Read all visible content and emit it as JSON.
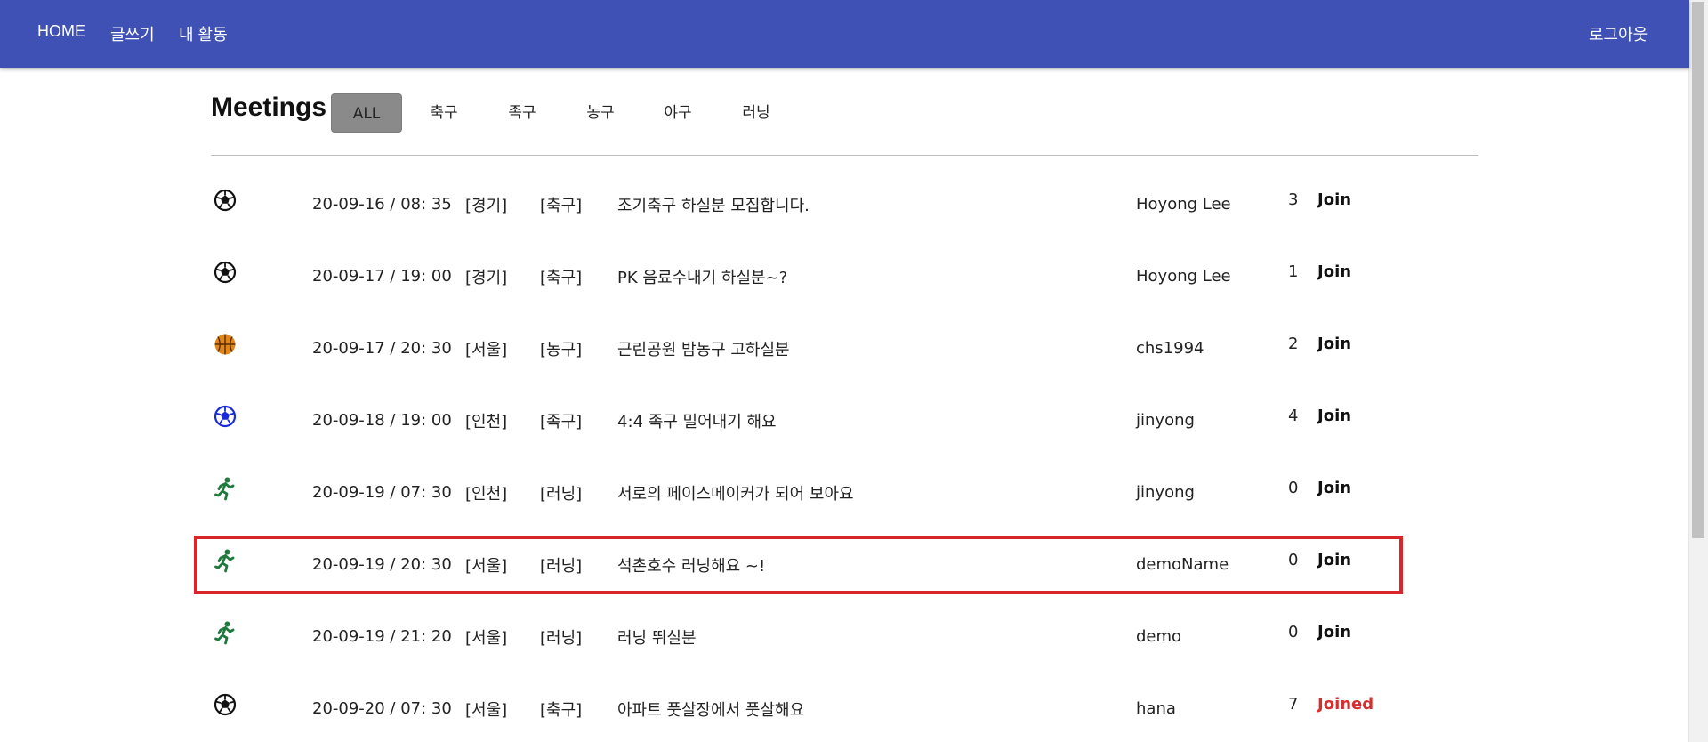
{
  "nav": {
    "home": "HOME",
    "write": "글쓰기",
    "activity": "내 활동",
    "logout": "로그아웃"
  },
  "page": {
    "title": "Meetings"
  },
  "filters": [
    "ALL",
    "축구",
    "족구",
    "농구",
    "야구",
    "러닝"
  ],
  "active_filter": "ALL",
  "colors": {
    "appbar": "#3f51b5",
    "joined": "#d32f2f",
    "highlight": "#d9262b",
    "basketball": "#e0861a",
    "jokgu": "#1a2ad6",
    "running": "#1e7a3b"
  },
  "meetings": [
    {
      "icon": "soccer-ball-icon",
      "date": "20-09-16 / 08: 35",
      "region": "[경기]",
      "category": "[축구]",
      "title": "조기축구 하실분 모집합니다.",
      "user": "Hoyong Lee",
      "count": "3",
      "status": "Join"
    },
    {
      "icon": "soccer-ball-icon",
      "date": "20-09-17 / 19: 00",
      "region": "[경기]",
      "category": "[축구]",
      "title": "PK 음료수내기 하실분~?",
      "user": "Hoyong Lee",
      "count": "1",
      "status": "Join"
    },
    {
      "icon": "basketball-icon",
      "date": "20-09-17 / 20: 30",
      "region": "[서울]",
      "category": "[농구]",
      "title": "근린공원 밤농구 고하실분",
      "user": "chs1994",
      "count": "2",
      "status": "Join"
    },
    {
      "icon": "jokgu-ball-icon",
      "date": "20-09-18 / 19: 00",
      "region": "[인천]",
      "category": "[족구]",
      "title": "4:4 족구 밀어내기 해요",
      "user": "jinyong",
      "count": "4",
      "status": "Join"
    },
    {
      "icon": "running-icon",
      "date": "20-09-19 / 07: 30",
      "region": "[인천]",
      "category": "[러닝]",
      "title": "서로의 페이스메이커가 되어 보아요",
      "user": "jinyong",
      "count": "0",
      "status": "Join"
    },
    {
      "icon": "running-icon",
      "date": "20-09-19 / 20: 30",
      "region": "[서울]",
      "category": "[러닝]",
      "title": "석촌호수 러닝해요 ~!",
      "user": "demoName",
      "count": "0",
      "status": "Join"
    },
    {
      "icon": "running-icon",
      "date": "20-09-19 / 21: 20",
      "region": "[서울]",
      "category": "[러닝]",
      "title": "러닝 뛰실분",
      "user": "demo",
      "count": "0",
      "status": "Join"
    },
    {
      "icon": "soccer-ball-icon",
      "date": "20-09-20 / 07: 30",
      "region": "[서울]",
      "category": "[축구]",
      "title": "아파트 풋살장에서 풋살해요",
      "user": "hana",
      "count": "7",
      "status": "Joined"
    }
  ]
}
